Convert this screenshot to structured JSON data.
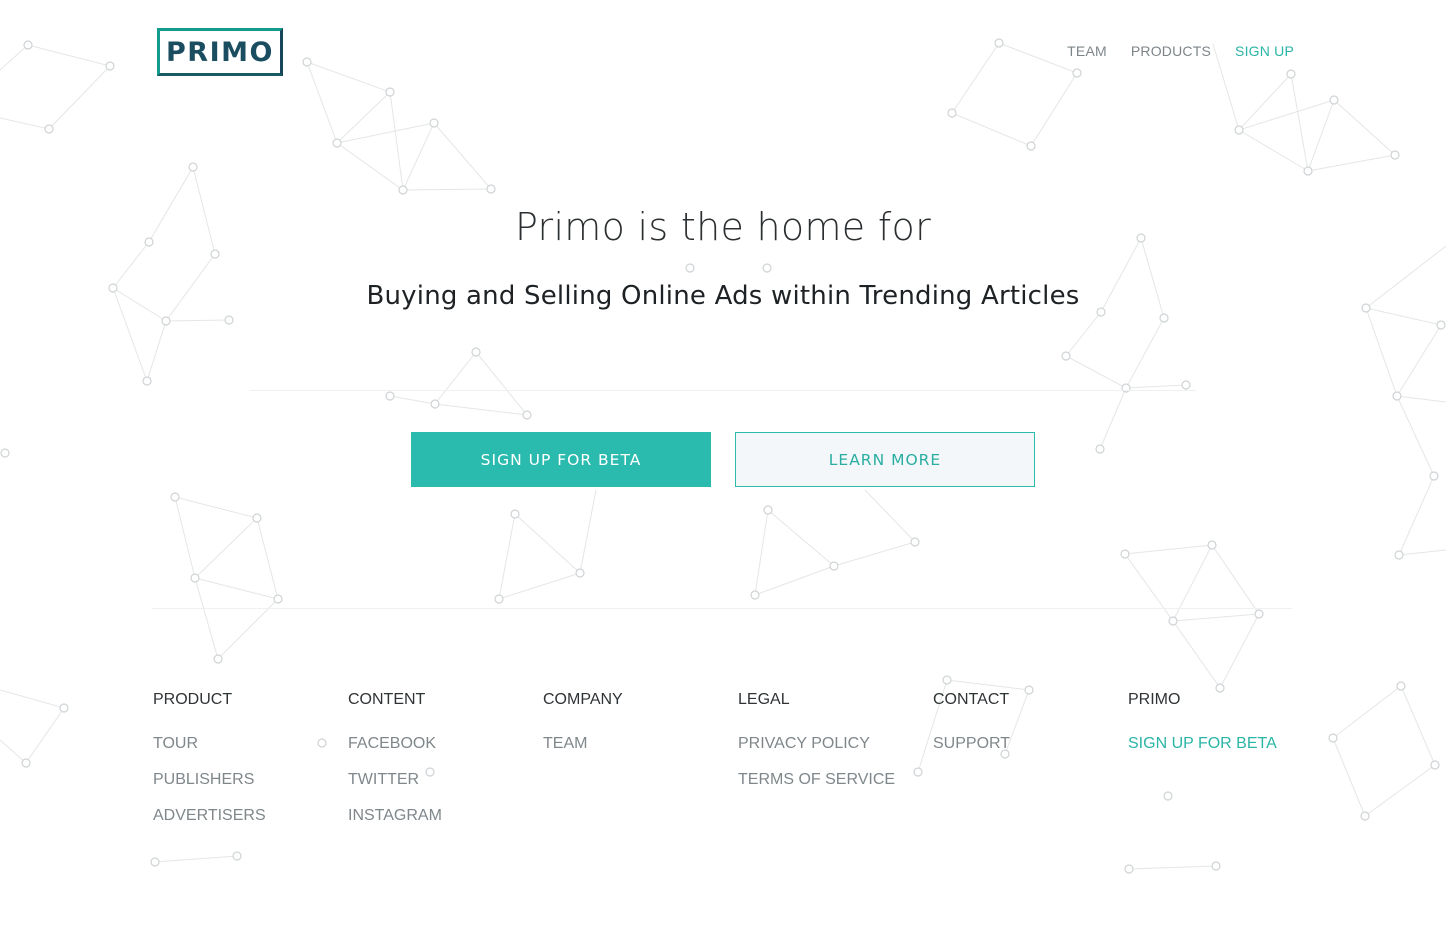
{
  "brand": {
    "logo_text": "PRIMO"
  },
  "nav": {
    "team": "TEAM",
    "products": "PRODUCTS",
    "signup": "SIGN UP"
  },
  "hero": {
    "subtitle": "Primo is the home for",
    "title": "Buying and Selling Online Ads within Trending Articles",
    "primary_button": "SIGN UP FOR BETA",
    "secondary_button": "LEARN MORE"
  },
  "footer": {
    "columns": [
      {
        "heading": "PRODUCT",
        "links": [
          "TOUR",
          "PUBLISHERS",
          "ADVERTISERS"
        ]
      },
      {
        "heading": "CONTENT",
        "links": [
          "FACEBOOK",
          "TWITTER",
          "INSTAGRAM"
        ]
      },
      {
        "heading": "COMPANY",
        "links": [
          "TEAM"
        ]
      },
      {
        "heading": "LEGAL",
        "links": [
          "PRIVACY POLICY",
          "TERMS OF SERVICE"
        ]
      },
      {
        "heading": "CONTACT",
        "links": [
          "SUPPORT"
        ]
      },
      {
        "heading": "PRIMO",
        "links": [
          "SIGN UP FOR BETA"
        ]
      }
    ]
  },
  "colors": {
    "accent": "#2abbae",
    "logo_dark": "#1b4d60",
    "text_muted": "#7f878b"
  }
}
